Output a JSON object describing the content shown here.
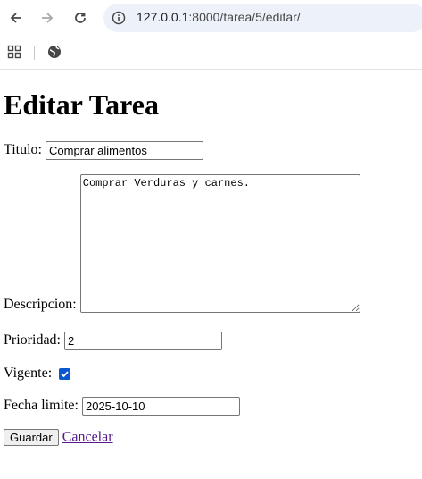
{
  "browser": {
    "url_host": "127.0.0.1",
    "url_rest": ":8000/tarea/5/editar/",
    "icons": {
      "back": "arrow-left-icon",
      "forward": "arrow-right-icon",
      "reload": "reload-icon",
      "info": "info-icon",
      "apps": "apps-grid-icon",
      "globe": "globe-icon"
    }
  },
  "form": {
    "heading": "Editar Tarea",
    "titulo_label": "Titulo:",
    "titulo_value": "Comprar alimentos",
    "descripcion_label": "Descripcion:",
    "descripcion_value": "Comprar Verduras y carnes.",
    "prioridad_label": "Prioridad:",
    "prioridad_value": "2",
    "vigente_label": "Vigente:",
    "vigente_checked": true,
    "fecha_label": "Fecha limite:",
    "fecha_value": "2025-10-10",
    "guardar_label": "Guardar",
    "cancelar_label": "Cancelar"
  }
}
